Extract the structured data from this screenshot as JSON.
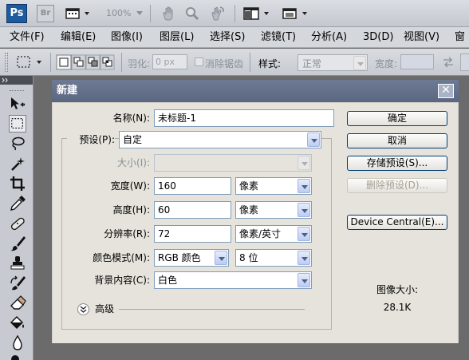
{
  "app": {
    "logo": "Ps",
    "bridge_logo": "Br",
    "zoom_level": "100%"
  },
  "menu": {
    "items": [
      "文件(F)",
      "编辑(E)",
      "图像(I)",
      "图层(L)",
      "选择(S)",
      "滤镜(T)",
      "分析(A)",
      "3D(D)",
      "视图(V)",
      "窗"
    ]
  },
  "options": {
    "feather_label": "羽化:",
    "feather_value": "0 px",
    "antialias_label": "消除锯齿",
    "style_label": "样式:",
    "style_value": "正常",
    "width_label": "宽度:"
  },
  "dialog": {
    "title": "新建",
    "name_label": "名称(N):",
    "name_value": "未标题-1",
    "preset_label": "预设(P):",
    "preset_value": "自定",
    "size_label": "大小(I):",
    "size_value": "",
    "width_label": "宽度(W):",
    "width_value": "160",
    "width_unit": "像素",
    "height_label": "高度(H):",
    "height_value": "60",
    "height_unit": "像素",
    "resolution_label": "分辨率(R):",
    "resolution_value": "72",
    "resolution_unit": "像素/英寸",
    "color_mode_label": "颜色模式(M):",
    "color_mode_value": "RGB 颜色",
    "bit_depth_value": "8 位",
    "background_label": "背景内容(C):",
    "background_value": "白色",
    "advanced_label": "高级",
    "ok_button": "确定",
    "cancel_button": "取消",
    "save_preset_button": "存储预设(S)...",
    "delete_preset_button": "删除预设(D)...",
    "device_central_button": "Device Central(E)...",
    "image_size_label": "图像大小:",
    "image_size_value": "28.1K"
  },
  "colors": {
    "dialog_title_bg": "#5a6781",
    "button_border": "#003c74",
    "field_border": "#7f9db9",
    "ps_logo_bg": "#1e5b9e"
  },
  "icons": {
    "toolbar": [
      "hand-icon",
      "zoom-icon",
      "rotate-view-icon",
      "arrange-documents-icon",
      "screen-mode-icon",
      "document-layout-icon"
    ],
    "tools": [
      "move-icon",
      "marquee-icon",
      "lasso-icon",
      "magic-wand-icon",
      "crop-icon",
      "eyedropper-icon",
      "healing-brush-icon",
      "brush-icon",
      "clone-stamp-icon",
      "history-brush-icon",
      "eraser-icon",
      "paint-bucket-icon",
      "blur-icon",
      "dodge-icon"
    ]
  }
}
